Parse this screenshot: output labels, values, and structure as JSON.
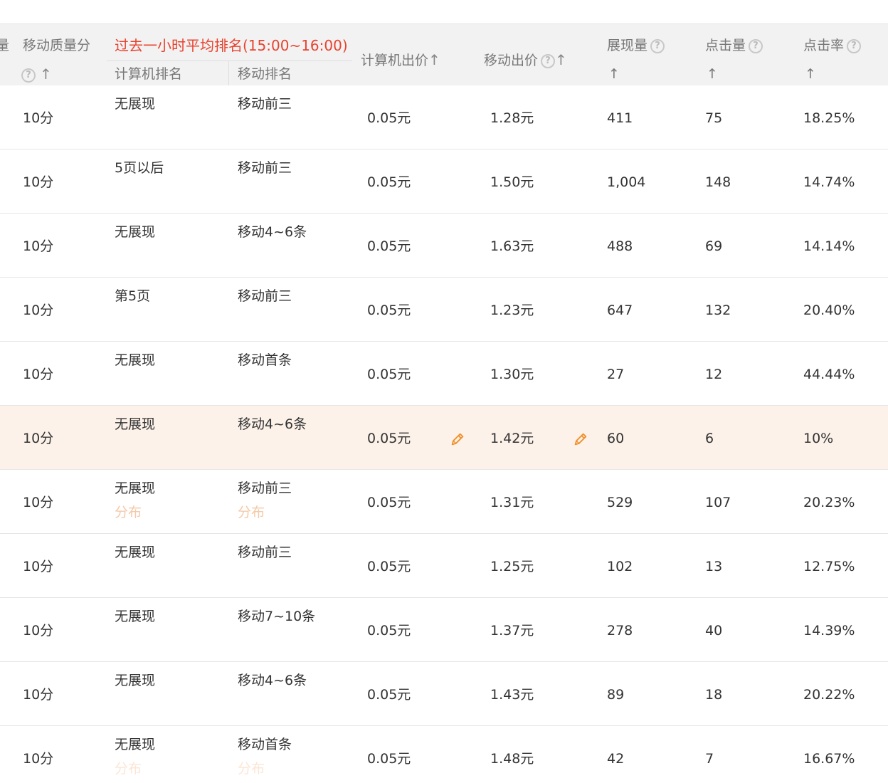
{
  "header": {
    "cut_col": "量",
    "quality": "移动质量分",
    "group_title": "过去一小时平均排名(15:00~16:00)",
    "pc_rank": "计算机排名",
    "mobile_rank": "移动排名",
    "pc_bid": "计算机出价",
    "mobile_bid": "移动出价",
    "impressions": "展现量",
    "clicks": "点击量",
    "ctr": "点击率",
    "sort_glyph": "↑",
    "help_glyph": "?"
  },
  "distribution_label": "分布",
  "colors": {
    "accent_red": "#e8432f",
    "pencil_orange": "#f0902a",
    "highlight_row": "#fcf2ea",
    "distribution_text": "#f5c9a8"
  },
  "rows": [
    {
      "quality": "10分",
      "pc_rank": "无展现",
      "mobile_rank": "移动前三",
      "pc_bid": "0.05元",
      "mobile_bid": "1.28元",
      "impressions": "411",
      "clicks": "75",
      "ctr": "18.25%"
    },
    {
      "quality": "10分",
      "pc_rank": "5页以后",
      "mobile_rank": "移动前三",
      "pc_bid": "0.05元",
      "mobile_bid": "1.50元",
      "impressions": "1,004",
      "clicks": "148",
      "ctr": "14.74%"
    },
    {
      "quality": "10分",
      "pc_rank": "无展现",
      "mobile_rank": "移动4~6条",
      "pc_bid": "0.05元",
      "mobile_bid": "1.63元",
      "impressions": "488",
      "clicks": "69",
      "ctr": "14.14%"
    },
    {
      "quality": "10分",
      "pc_rank": "第5页",
      "mobile_rank": "移动前三",
      "pc_bid": "0.05元",
      "mobile_bid": "1.23元",
      "impressions": "647",
      "clicks": "132",
      "ctr": "20.40%"
    },
    {
      "quality": "10分",
      "pc_rank": "无展现",
      "mobile_rank": "移动首条",
      "pc_bid": "0.05元",
      "mobile_bid": "1.30元",
      "impressions": "27",
      "clicks": "12",
      "ctr": "44.44%"
    },
    {
      "quality": "10分",
      "pc_rank": "无展现",
      "mobile_rank": "移动4~6条",
      "pc_bid": "0.05元",
      "mobile_bid": "1.42元",
      "impressions": "60",
      "clicks": "6",
      "ctr": "10%",
      "highlight": true
    },
    {
      "quality": "10分",
      "pc_rank": "无展现",
      "mobile_rank": "移动前三",
      "pc_bid": "0.05元",
      "mobile_bid": "1.31元",
      "impressions": "529",
      "clicks": "107",
      "ctr": "20.23%",
      "dist": "normal"
    },
    {
      "quality": "10分",
      "pc_rank": "无展现",
      "mobile_rank": "移动前三",
      "pc_bid": "0.05元",
      "mobile_bid": "1.25元",
      "impressions": "102",
      "clicks": "13",
      "ctr": "12.75%"
    },
    {
      "quality": "10分",
      "pc_rank": "无展现",
      "mobile_rank": "移动7~10条",
      "pc_bid": "0.05元",
      "mobile_bid": "1.37元",
      "impressions": "278",
      "clicks": "40",
      "ctr": "14.39%"
    },
    {
      "quality": "10分",
      "pc_rank": "无展现",
      "mobile_rank": "移动4~6条",
      "pc_bid": "0.05元",
      "mobile_bid": "1.43元",
      "impressions": "89",
      "clicks": "18",
      "ctr": "20.22%"
    },
    {
      "quality": "10分",
      "pc_rank": "无展现",
      "mobile_rank": "移动首条",
      "pc_bid": "0.05元",
      "mobile_bid": "1.48元",
      "impressions": "42",
      "clicks": "7",
      "ctr": "16.67%",
      "dist": "faint"
    }
  ]
}
